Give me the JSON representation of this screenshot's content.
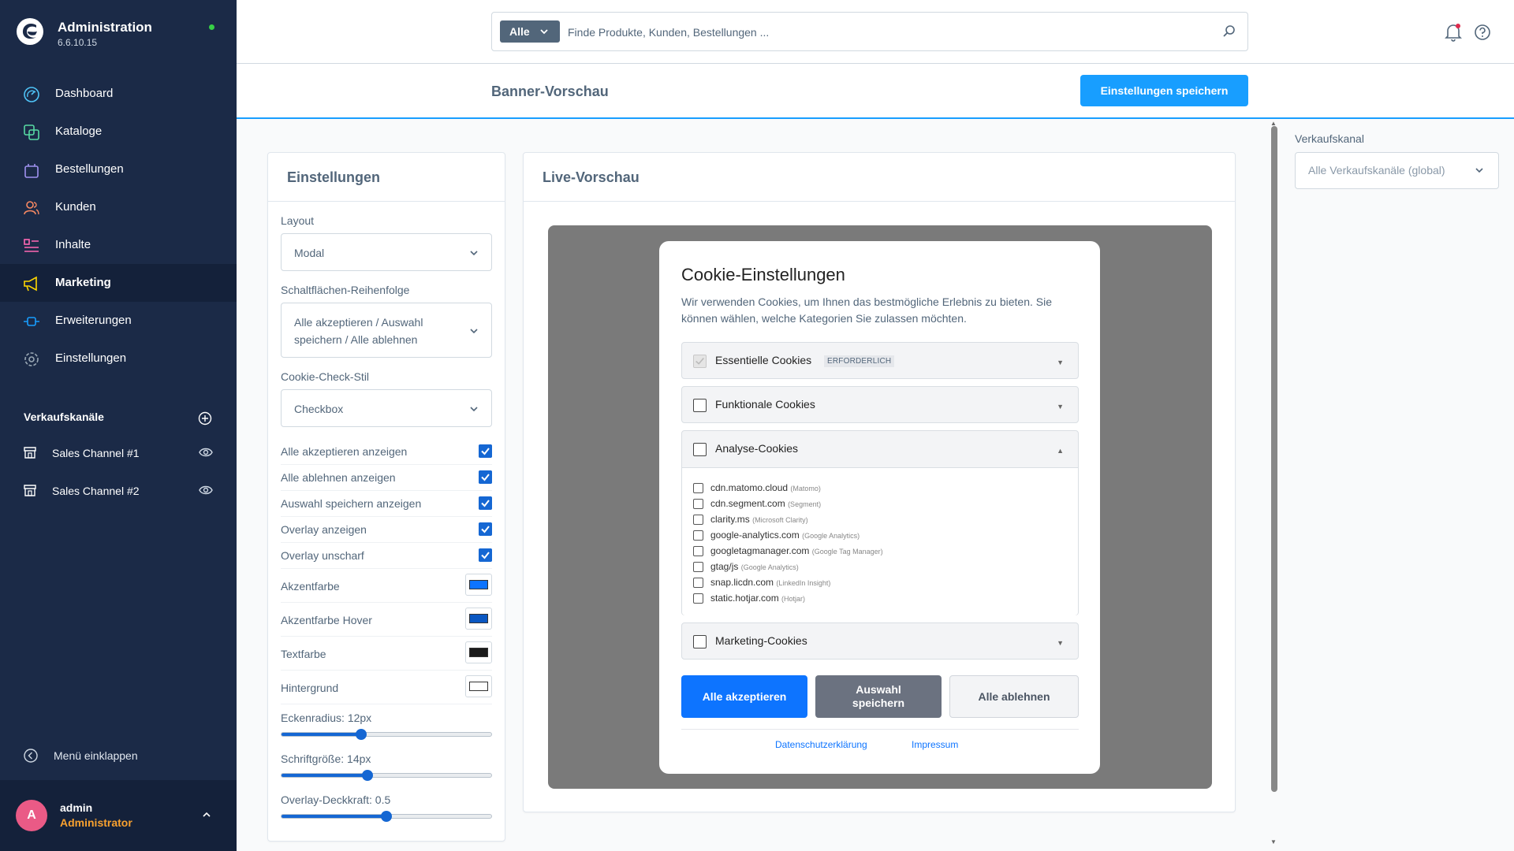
{
  "sidebar": {
    "brand_title": "Administration",
    "brand_version": "6.6.10.15",
    "nav": [
      {
        "label": "Dashboard",
        "icon": "dashboard-icon",
        "active": false
      },
      {
        "label": "Kataloge",
        "icon": "catalog-icon",
        "active": false
      },
      {
        "label": "Bestellungen",
        "icon": "shopping-bag-icon",
        "active": false
      },
      {
        "label": "Kunden",
        "icon": "users-icon",
        "active": false
      },
      {
        "label": "Inhalte",
        "icon": "content-icon",
        "active": false
      },
      {
        "label": "Marketing",
        "icon": "megaphone-icon",
        "active": true
      },
      {
        "label": "Erweiterungen",
        "icon": "plug-icon",
        "active": false
      },
      {
        "label": "Einstellungen",
        "icon": "gear-icon",
        "active": false
      }
    ],
    "sales_channels_header": "Verkaufskanäle",
    "sales_channels": [
      {
        "label": "Sales Channel #1"
      },
      {
        "label": "Sales Channel #2"
      }
    ],
    "collapse_label": "Menü einklappen",
    "user": {
      "initial": "A",
      "name": "admin",
      "role": "Administrator"
    }
  },
  "topbar": {
    "search_type": "Alle",
    "search_placeholder": "Finde Produkte, Kunden, Bestellungen ..."
  },
  "page": {
    "title": "Banner-Vorschau",
    "save_label": "Einstellungen speichern"
  },
  "settings": {
    "title": "Einstellungen",
    "layout_label": "Layout",
    "layout_value": "Modal",
    "order_label": "Schaltflächen-Reihenfolge",
    "order_value_line1": "Alle akzeptieren / Auswahl",
    "order_value_line2": "speichern / Alle ablehnen",
    "check_style_label": "Cookie-Check-Stil",
    "check_style_value": "Checkbox",
    "toggles": [
      {
        "label": "Alle akzeptieren anzeigen",
        "checked": true
      },
      {
        "label": "Alle ablehnen anzeigen",
        "checked": true
      },
      {
        "label": "Auswahl speichern anzeigen",
        "checked": true
      },
      {
        "label": "Overlay anzeigen",
        "checked": true
      },
      {
        "label": "Overlay unscharf",
        "checked": true
      }
    ],
    "colors": [
      {
        "label": "Akzentfarbe",
        "value": "#0d74ff"
      },
      {
        "label": "Akzentfarbe Hover",
        "value": "#0a57c2"
      },
      {
        "label": "Textfarbe",
        "value": "#1a1a1a"
      },
      {
        "label": "Hintergrund",
        "value": "#ffffff"
      }
    ],
    "sliders": [
      {
        "label": "Eckenradius: 12px",
        "fraction": 0.38
      },
      {
        "label": "Schriftgröße: 14px",
        "fraction": 0.41
      },
      {
        "label": "Overlay-Deckkraft: 0.5",
        "fraction": 0.5
      }
    ]
  },
  "preview": {
    "title": "Live-Vorschau",
    "modal": {
      "title": "Cookie-Einstellungen",
      "description": "Wir verwenden Cookies, um Ihnen das bestmögliche Erlebnis zu bieten. Sie können wählen, welche Kategorien Sie zulassen möchten.",
      "categories": [
        {
          "label": "Essentielle Cookies",
          "badge": "ERFORDERLICH",
          "arrow": "▼"
        },
        {
          "label": "Funktionale Cookies",
          "arrow": "▼"
        },
        {
          "label": "Analyse-Cookies",
          "arrow": "▲"
        },
        {
          "label": "Marketing-Cookies",
          "arrow": "▼"
        }
      ],
      "services": [
        {
          "name": "cdn.matomo.cloud",
          "vendor": "(Matomo)"
        },
        {
          "name": "cdn.segment.com",
          "vendor": "(Segment)"
        },
        {
          "name": "clarity.ms",
          "vendor": "(Microsoft Clarity)"
        },
        {
          "name": "google-analytics.com",
          "vendor": "(Google Analytics)"
        },
        {
          "name": "googletagmanager.com",
          "vendor": "(Google Tag Manager)"
        },
        {
          "name": "gtag/js",
          "vendor": "(Google Analytics)"
        },
        {
          "name": "snap.licdn.com",
          "vendor": "(LinkedIn Insight)"
        },
        {
          "name": "static.hotjar.com",
          "vendor": "(Hotjar)"
        }
      ],
      "accept_label": "Alle akzeptieren",
      "save_label_line1": "Auswahl",
      "save_label_line2": "speichern",
      "reject_label": "Alle ablehnen",
      "privacy_link": "Datenschutzerklärung",
      "imprint_link": "Impressum"
    }
  },
  "right_panel": {
    "label": "Verkaufskanal",
    "placeholder": "Alle Verkaufskanäle (global)"
  },
  "colors": {
    "sidebar_bg": "#1b2a47",
    "primary": "#189eff",
    "modal_accent": "#0d74ff"
  }
}
